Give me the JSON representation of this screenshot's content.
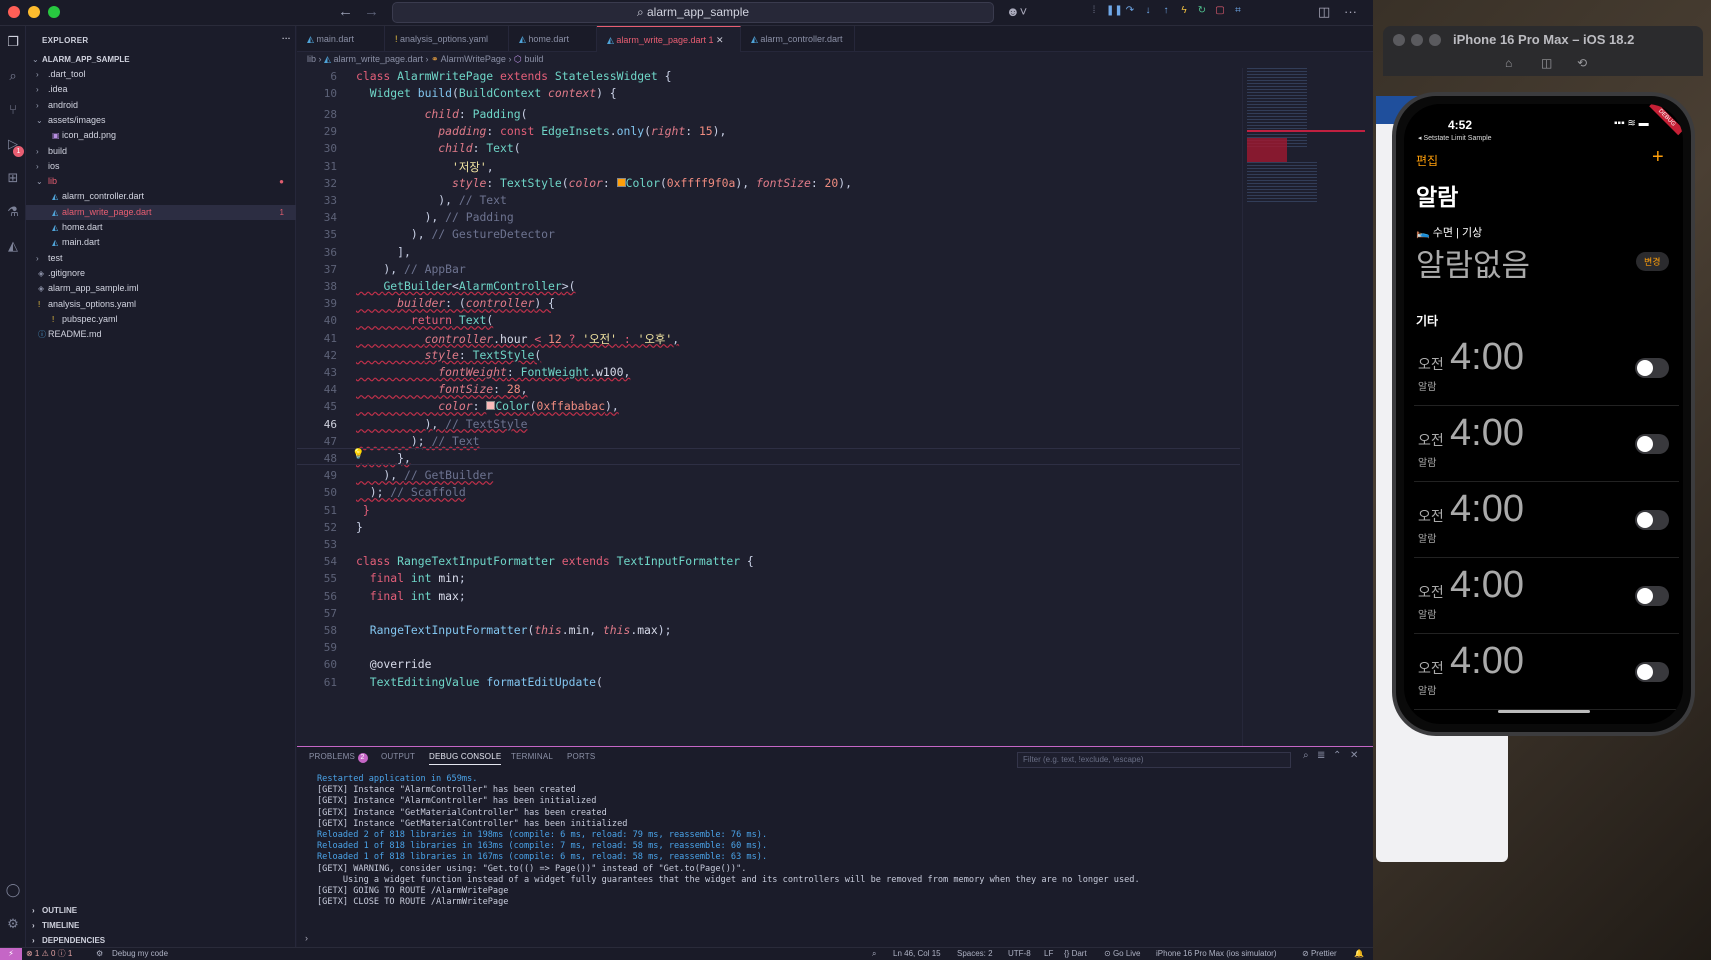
{
  "window": {
    "title": "alarm_app_sample"
  },
  "activity_bar": {
    "debug_badge": "1"
  },
  "explorer": {
    "header": "EXPLORER",
    "project": "ALARM_APP_SAMPLE",
    "items": [
      {
        "label": ".dart_tool",
        "type": "folder"
      },
      {
        "label": ".idea",
        "type": "folder"
      },
      {
        "label": "android",
        "type": "folder"
      },
      {
        "label": "assets/images",
        "type": "folder-open"
      },
      {
        "label": "icon_add.png",
        "type": "image"
      },
      {
        "label": "build",
        "type": "folder"
      },
      {
        "label": "ios",
        "type": "folder"
      },
      {
        "label": "lib",
        "type": "folder-open"
      },
      {
        "label": "alarm_controller.dart",
        "type": "dart"
      },
      {
        "label": "alarm_write_page.dart",
        "type": "dart",
        "badge": "1"
      },
      {
        "label": "home.dart",
        "type": "dart"
      },
      {
        "label": "main.dart",
        "type": "dart"
      },
      {
        "label": "test",
        "type": "folder"
      },
      {
        "label": ".gitignore",
        "type": "file"
      },
      {
        "label": "alarm_app_sample.iml",
        "type": "file"
      },
      {
        "label": "analysis_options.yaml",
        "type": "yaml"
      },
      {
        "label": "pubspec.yaml",
        "type": "yaml"
      },
      {
        "label": "README.md",
        "type": "info"
      }
    ],
    "bottom": [
      "OUTLINE",
      "TIMELINE",
      "DEPENDENCIES"
    ]
  },
  "tabs": [
    {
      "label": "main.dart"
    },
    {
      "label": "analysis_options.yaml"
    },
    {
      "label": "home.dart"
    },
    {
      "label": "alarm_write_page.dart 1",
      "active": true
    },
    {
      "label": "alarm_controller.dart"
    }
  ],
  "breadcrumb": [
    "lib",
    "alarm_write_page.dart",
    "AlarmWritePage",
    "build"
  ],
  "line_numbers": [
    "6",
    "10",
    "28",
    "29",
    "30",
    "31",
    "32",
    "33",
    "34",
    "35",
    "36",
    "37",
    "38",
    "39",
    "40",
    "41",
    "42",
    "43",
    "44",
    "45",
    "46",
    "47",
    "48",
    "49",
    "50",
    "51",
    "52",
    "53",
    "54",
    "55",
    "56",
    "57",
    "58",
    "59",
    "60",
    "61"
  ],
  "panel": {
    "tabs": [
      "PROBLEMS",
      "OUTPUT",
      "DEBUG CONSOLE",
      "TERMINAL",
      "PORTS"
    ],
    "problems_count": "2",
    "filter_placeholder": "Filter (e.g. text, !exclude, \\escape)",
    "console": [
      {
        "text": "Restarted application in 659ms.",
        "color": "#4aa3e8"
      },
      {
        "text": "[GETX] Instance \"AlarmController\" has been created",
        "color": "#c8ccdc"
      },
      {
        "text": "[GETX] Instance \"AlarmController\" has been initialized",
        "color": "#c8ccdc"
      },
      {
        "text": "[GETX] Instance \"GetMaterialController\" has been created",
        "color": "#c8ccdc"
      },
      {
        "text": "[GETX] Instance \"GetMaterialController\" has been initialized",
        "color": "#c8ccdc"
      },
      {
        "text": "Reloaded 2 of 818 libraries in 198ms (compile: 6 ms, reload: 79 ms, reassemble: 76 ms).",
        "color": "#4aa3e8"
      },
      {
        "text": "Reloaded 1 of 818 libraries in 163ms (compile: 7 ms, reload: 58 ms, reassemble: 60 ms).",
        "color": "#4aa3e8"
      },
      {
        "text": "Reloaded 1 of 818 libraries in 167ms (compile: 6 ms, reload: 58 ms, reassemble: 63 ms).",
        "color": "#4aa3e8"
      },
      {
        "text": "[GETX] WARNING, consider using: \"Get.to(() => Page())\" instead of \"Get.to(Page())\".",
        "color": "#c8ccdc"
      },
      {
        "text": "     Using a widget function instead of a widget fully guarantees that the widget and its controllers will be removed from memory when they are no longer used.",
        "color": "#c8ccdc"
      },
      {
        "text": "[GETX] GOING TO ROUTE /AlarmWritePage",
        "color": "#c8ccdc"
      },
      {
        "text": "[GETX] CLOSE TO ROUTE /AlarmWritePage",
        "color": "#c8ccdc"
      }
    ]
  },
  "status": {
    "problems": "⊗ 1 ⚠ 0 ⓘ 1",
    "debug": "Debug my code",
    "position": "Ln 46, Col 15",
    "spaces": "Spaces: 2",
    "encoding": "UTF-8",
    "eol": "LF",
    "language": "{} Dart",
    "golive": "Go Live",
    "device": "iPhone 16 Pro Max (ios simulator)",
    "prettier": "Prettier"
  },
  "simulator": {
    "title": "iPhone 16 Pro Max – iOS 18.2",
    "time": "4:52",
    "back_label": "◂ Setstate Limit Sample",
    "debug_ribbon": "DEBUG",
    "edit": "편집",
    "add": "+",
    "heading": "알람",
    "sleep_label": "수면 | 기상",
    "no_alarm": "알람없음",
    "change": "변경",
    "other": "기타",
    "alarms": [
      {
        "ampm": "오전",
        "time": "4:00",
        "label": "알람"
      },
      {
        "ampm": "오전",
        "time": "4:00",
        "label": "알람"
      },
      {
        "ampm": "오전",
        "time": "4:00",
        "label": "알람"
      },
      {
        "ampm": "오전",
        "time": "4:00",
        "label": "알람"
      },
      {
        "ampm": "오전",
        "time": "4:00",
        "label": "알람"
      }
    ]
  }
}
